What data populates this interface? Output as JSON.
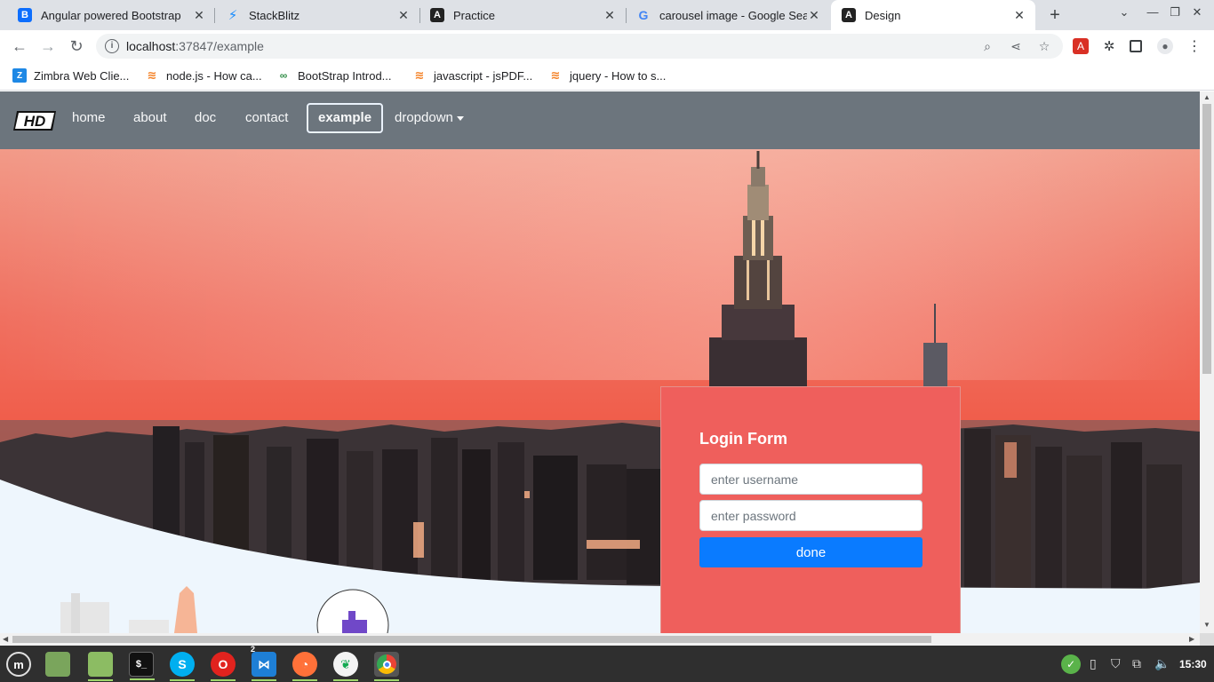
{
  "tabs": [
    {
      "title": "Angular powered Bootstrap",
      "icon": "bootstrap-icon"
    },
    {
      "title": "StackBlitz",
      "icon": "stackblitz-icon"
    },
    {
      "title": "Practice",
      "icon": "angular-icon"
    },
    {
      "title": "carousel image - Google Sea",
      "icon": "google-icon"
    },
    {
      "title": "Design",
      "icon": "angular-icon",
      "active": true
    }
  ],
  "address": {
    "host": "localhost",
    "path": ":37847/example"
  },
  "bookmarks": [
    {
      "label": "Zimbra Web Clie...",
      "icon": "zimbra-icon"
    },
    {
      "label": "node.js - How ca...",
      "icon": "stackoverflow-icon"
    },
    {
      "label": "BootStrap Introd...",
      "icon": "geeksforgeeks-icon"
    },
    {
      "label": "javascript - jsPDF...",
      "icon": "stackoverflow-icon"
    },
    {
      "label": "jquery - How to s...",
      "icon": "stackoverflow-icon"
    }
  ],
  "navbar": {
    "brand": "HD",
    "links": [
      "home",
      "about",
      "doc",
      "contact",
      "example",
      "dropdown"
    ],
    "active": "example"
  },
  "login": {
    "title": "Login Form",
    "username_placeholder": "enter username",
    "password_placeholder": "enter password",
    "submit_label": "done"
  },
  "taskbar": {
    "badge": "2",
    "clock": "15:30"
  },
  "colors": {
    "navbar": "#6c757d",
    "login_bg": "#ef5f5c",
    "button": "#0a7bff",
    "taskbar": "#2f2f2f"
  }
}
